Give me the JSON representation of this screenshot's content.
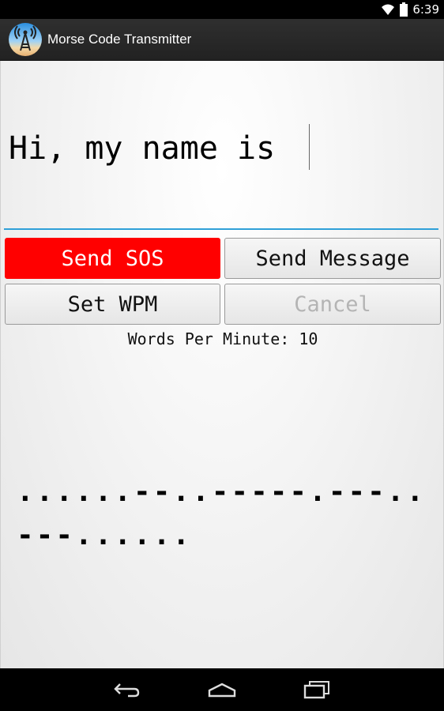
{
  "status_bar": {
    "time": "6:39",
    "wifi_icon": "wifi-icon",
    "battery_icon": "battery-icon"
  },
  "action_bar": {
    "app_icon": "radio-tower-icon",
    "title": "Morse Code Transmitter"
  },
  "message": {
    "value": "Hi, my name is "
  },
  "buttons": {
    "send_sos": "Send SOS",
    "send_message": "Send Message",
    "set_wpm": "Set WPM",
    "cancel": "Cancel"
  },
  "wpm_label": "Words Per Minute: 10",
  "morse_output": "......--..-----.---..---......",
  "nav_bar": {
    "back_icon": "back-icon",
    "home_icon": "home-icon",
    "recent_apps_icon": "recent-apps-icon"
  },
  "colors": {
    "sos_button": "#ff0000",
    "input_underline": "#2fa0d8",
    "disabled_text": "#b4b4b4"
  }
}
